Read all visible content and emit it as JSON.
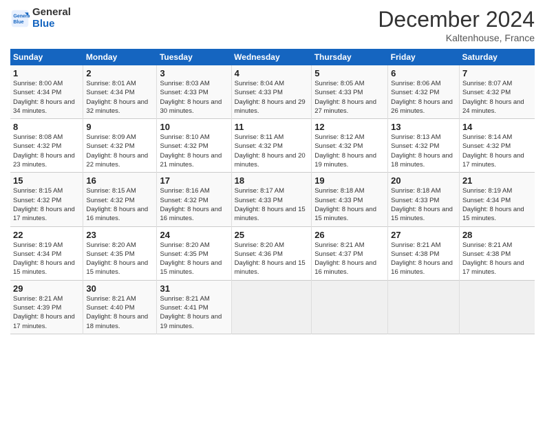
{
  "logo": {
    "line1": "General",
    "line2": "Blue"
  },
  "header": {
    "title": "December 2024",
    "subtitle": "Kaltenhouse, France"
  },
  "weekdays": [
    "Sunday",
    "Monday",
    "Tuesday",
    "Wednesday",
    "Thursday",
    "Friday",
    "Saturday"
  ],
  "weeks": [
    [
      {
        "day": "1",
        "sunrise": "8:00 AM",
        "sunset": "4:34 PM",
        "daylight": "8 hours and 34 minutes."
      },
      {
        "day": "2",
        "sunrise": "8:01 AM",
        "sunset": "4:34 PM",
        "daylight": "8 hours and 32 minutes."
      },
      {
        "day": "3",
        "sunrise": "8:03 AM",
        "sunset": "4:33 PM",
        "daylight": "8 hours and 30 minutes."
      },
      {
        "day": "4",
        "sunrise": "8:04 AM",
        "sunset": "4:33 PM",
        "daylight": "8 hours and 29 minutes."
      },
      {
        "day": "5",
        "sunrise": "8:05 AM",
        "sunset": "4:33 PM",
        "daylight": "8 hours and 27 minutes."
      },
      {
        "day": "6",
        "sunrise": "8:06 AM",
        "sunset": "4:32 PM",
        "daylight": "8 hours and 26 minutes."
      },
      {
        "day": "7",
        "sunrise": "8:07 AM",
        "sunset": "4:32 PM",
        "daylight": "8 hours and 24 minutes."
      }
    ],
    [
      {
        "day": "8",
        "sunrise": "8:08 AM",
        "sunset": "4:32 PM",
        "daylight": "8 hours and 23 minutes."
      },
      {
        "day": "9",
        "sunrise": "8:09 AM",
        "sunset": "4:32 PM",
        "daylight": "8 hours and 22 minutes."
      },
      {
        "day": "10",
        "sunrise": "8:10 AM",
        "sunset": "4:32 PM",
        "daylight": "8 hours and 21 minutes."
      },
      {
        "day": "11",
        "sunrise": "8:11 AM",
        "sunset": "4:32 PM",
        "daylight": "8 hours and 20 minutes."
      },
      {
        "day": "12",
        "sunrise": "8:12 AM",
        "sunset": "4:32 PM",
        "daylight": "8 hours and 19 minutes."
      },
      {
        "day": "13",
        "sunrise": "8:13 AM",
        "sunset": "4:32 PM",
        "daylight": "8 hours and 18 minutes."
      },
      {
        "day": "14",
        "sunrise": "8:14 AM",
        "sunset": "4:32 PM",
        "daylight": "8 hours and 17 minutes."
      }
    ],
    [
      {
        "day": "15",
        "sunrise": "8:15 AM",
        "sunset": "4:32 PM",
        "daylight": "8 hours and 17 minutes."
      },
      {
        "day": "16",
        "sunrise": "8:15 AM",
        "sunset": "4:32 PM",
        "daylight": "8 hours and 16 minutes."
      },
      {
        "day": "17",
        "sunrise": "8:16 AM",
        "sunset": "4:32 PM",
        "daylight": "8 hours and 16 minutes."
      },
      {
        "day": "18",
        "sunrise": "8:17 AM",
        "sunset": "4:33 PM",
        "daylight": "8 hours and 15 minutes."
      },
      {
        "day": "19",
        "sunrise": "8:18 AM",
        "sunset": "4:33 PM",
        "daylight": "8 hours and 15 minutes."
      },
      {
        "day": "20",
        "sunrise": "8:18 AM",
        "sunset": "4:33 PM",
        "daylight": "8 hours and 15 minutes."
      },
      {
        "day": "21",
        "sunrise": "8:19 AM",
        "sunset": "4:34 PM",
        "daylight": "8 hours and 15 minutes."
      }
    ],
    [
      {
        "day": "22",
        "sunrise": "8:19 AM",
        "sunset": "4:34 PM",
        "daylight": "8 hours and 15 minutes."
      },
      {
        "day": "23",
        "sunrise": "8:20 AM",
        "sunset": "4:35 PM",
        "daylight": "8 hours and 15 minutes."
      },
      {
        "day": "24",
        "sunrise": "8:20 AM",
        "sunset": "4:35 PM",
        "daylight": "8 hours and 15 minutes."
      },
      {
        "day": "25",
        "sunrise": "8:20 AM",
        "sunset": "4:36 PM",
        "daylight": "8 hours and 15 minutes."
      },
      {
        "day": "26",
        "sunrise": "8:21 AM",
        "sunset": "4:37 PM",
        "daylight": "8 hours and 16 minutes."
      },
      {
        "day": "27",
        "sunrise": "8:21 AM",
        "sunset": "4:38 PM",
        "daylight": "8 hours and 16 minutes."
      },
      {
        "day": "28",
        "sunrise": "8:21 AM",
        "sunset": "4:38 PM",
        "daylight": "8 hours and 17 minutes."
      }
    ],
    [
      {
        "day": "29",
        "sunrise": "8:21 AM",
        "sunset": "4:39 PM",
        "daylight": "8 hours and 17 minutes."
      },
      {
        "day": "30",
        "sunrise": "8:21 AM",
        "sunset": "4:40 PM",
        "daylight": "8 hours and 18 minutes."
      },
      {
        "day": "31",
        "sunrise": "8:21 AM",
        "sunset": "4:41 PM",
        "daylight": "8 hours and 19 minutes."
      },
      null,
      null,
      null,
      null
    ]
  ]
}
